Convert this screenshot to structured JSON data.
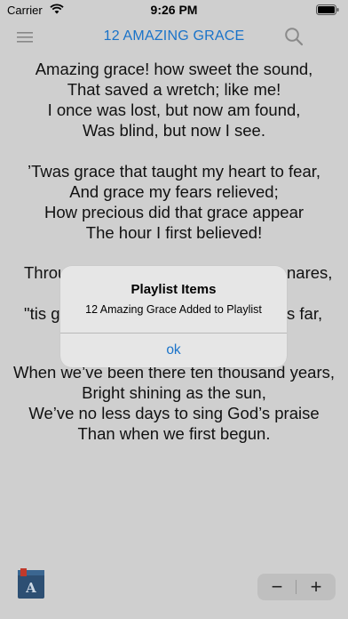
{
  "status_bar": {
    "carrier": "Carrier",
    "time": "9:26 PM"
  },
  "nav": {
    "title": "12 AMAZING GRACE",
    "menu_icon": "hamburger-menu-icon",
    "search_icon": "magnifier-icon"
  },
  "lyrics": {
    "stanzas": [
      [
        "Amazing grace! how sweet the sound,",
        "That saved a wretch; like me!",
        "I once was lost, but now am found,",
        "Was blind, but now I see."
      ],
      [
        "’Twas grace that taught my heart to fear,",
        "And grace my fears relieved;",
        "How precious did that grace appear",
        "The hour I first believed!"
      ],
      [
        "Throu",
        "\"tis g"
      ],
      [
        "When we’ve been there ten thousand years,",
        "Bright shining as the sun,",
        "We’ve no less days to sing God’s praise",
        "Than when we first begun."
      ]
    ],
    "partial_right": [
      "nares,",
      "s far,"
    ]
  },
  "alert": {
    "title": "Playlist Items",
    "message": "12 Amazing Grace Added to Playlist",
    "ok_label": "ok"
  },
  "bottom": {
    "book_icon": "hymnal-book-icon",
    "zoom_out_label": "−",
    "zoom_in_label": "+"
  },
  "colors": {
    "accent": "#1a73c9",
    "background": "#cfcfcf",
    "alert_bg": "#e6e6e6"
  }
}
